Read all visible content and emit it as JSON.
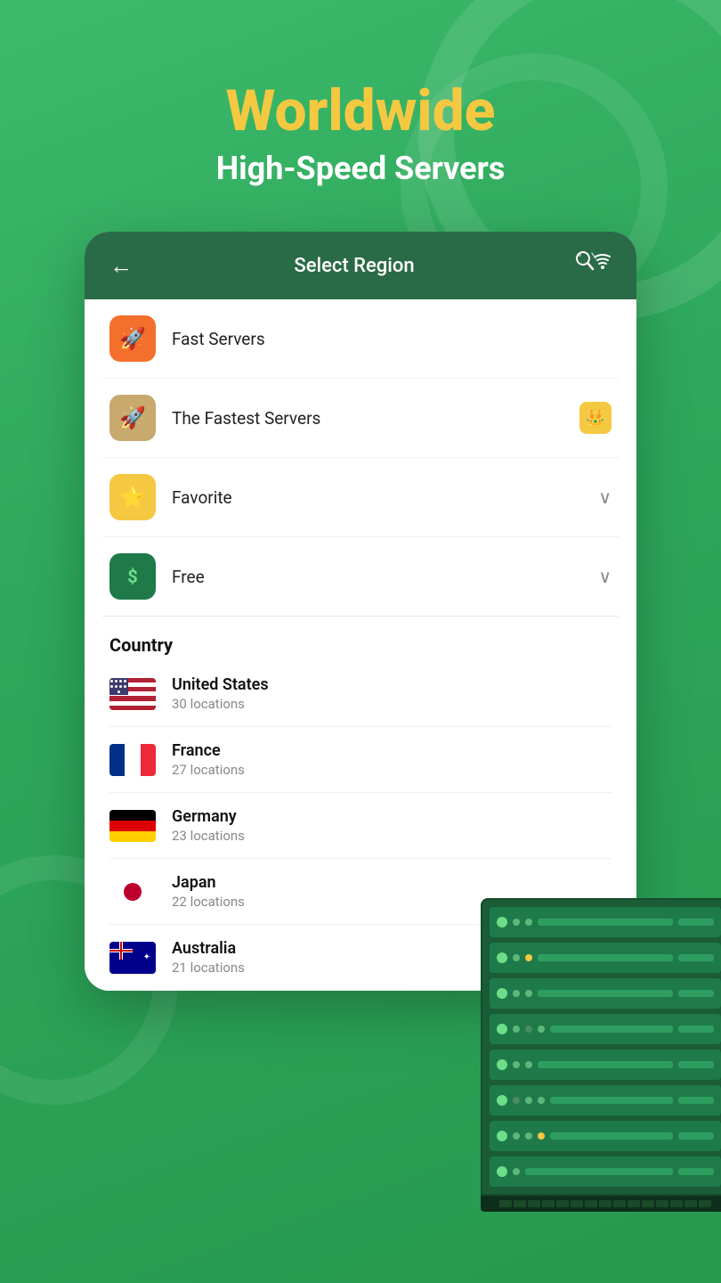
{
  "page": {
    "background_color": "#3cb96a"
  },
  "header": {
    "title": "Worldwide",
    "subtitle": "High-Speed Servers"
  },
  "card": {
    "nav_title": "Select Region",
    "back_label": "←"
  },
  "menu_items": [
    {
      "id": "fast-servers",
      "label": "Fast Servers",
      "icon_type": "orange",
      "icon": "🚀",
      "badge": null,
      "chevron": false
    },
    {
      "id": "fastest-servers",
      "label": "The Fastest Servers",
      "icon_type": "tan",
      "icon": "🚀",
      "badge": "crown",
      "chevron": false
    },
    {
      "id": "favorite",
      "label": "Favorite",
      "icon_type": "yellow",
      "icon": "⭐",
      "badge": null,
      "chevron": true
    },
    {
      "id": "free",
      "label": "Free",
      "icon_type": "green",
      "icon": "$",
      "badge": null,
      "chevron": true
    }
  ],
  "country_section": {
    "heading": "Country"
  },
  "countries": [
    {
      "id": "us",
      "name": "United States",
      "locations": "30 locations",
      "flag": "us"
    },
    {
      "id": "fr",
      "name": "France",
      "locations": "27 locations",
      "flag": "fr"
    },
    {
      "id": "de",
      "name": "Germany",
      "locations": "23 locations",
      "flag": "de"
    },
    {
      "id": "jp",
      "name": "Japan",
      "locations": "22 locations",
      "flag": "jp"
    },
    {
      "id": "au",
      "name": "Australia",
      "locations": "21 locations",
      "flag": "au"
    }
  ],
  "server_rack": {
    "units": 8
  }
}
